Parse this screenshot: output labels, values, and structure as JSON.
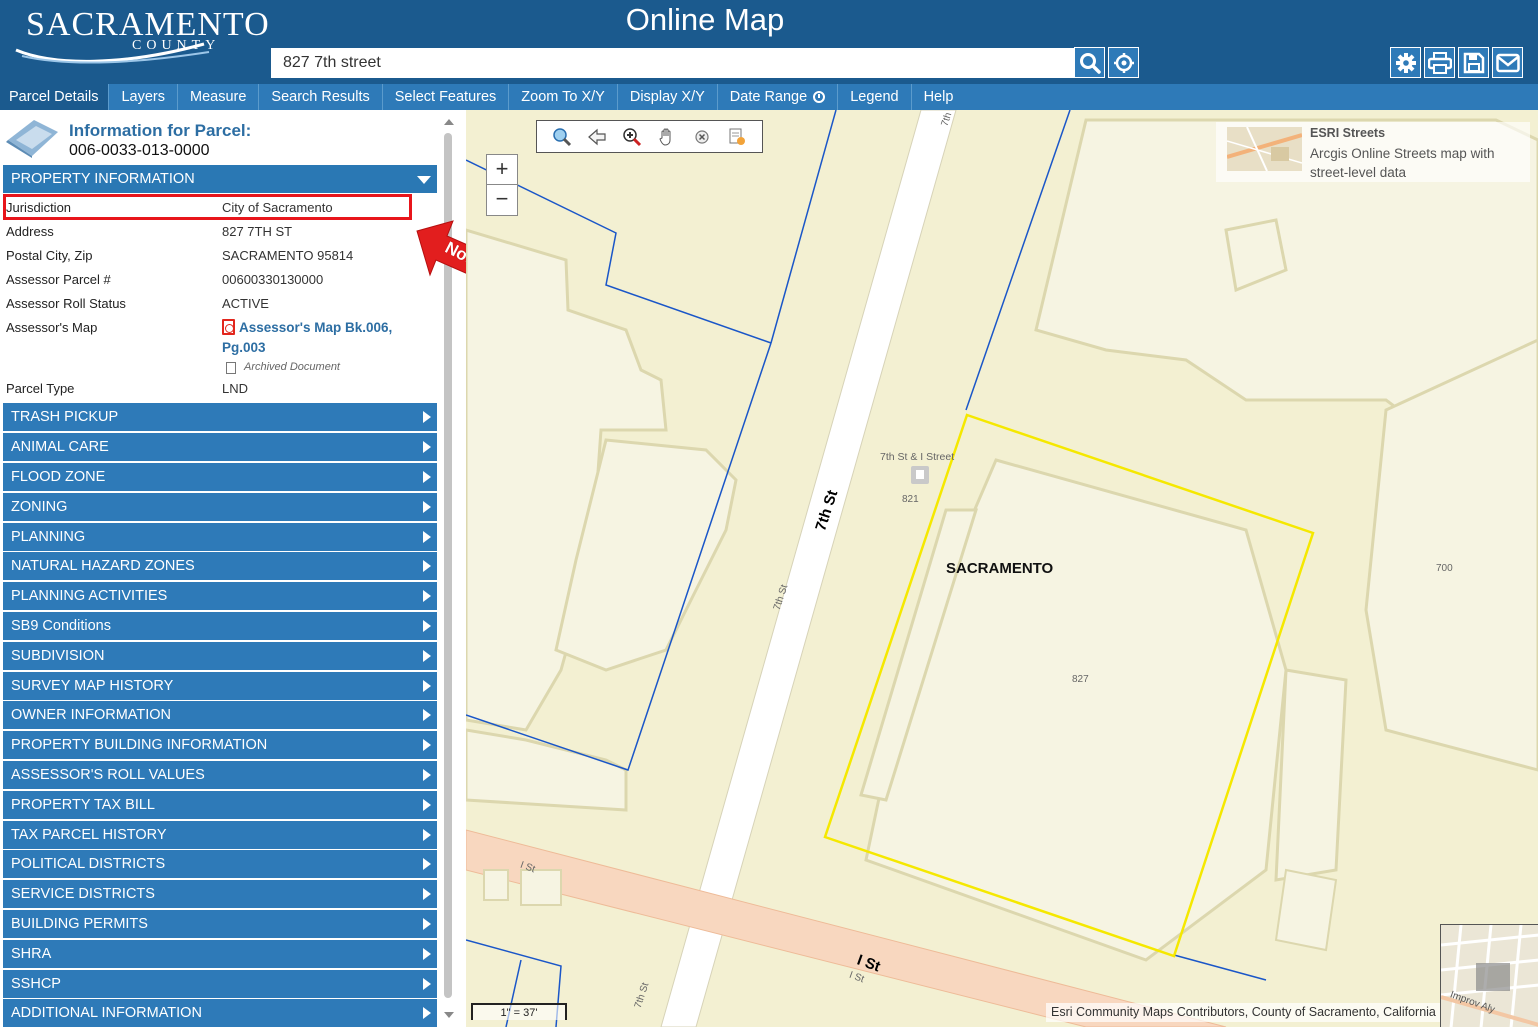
{
  "header": {
    "logo_main": "SACRAMENTO",
    "logo_sub": "COUNTY",
    "title": "Online Map",
    "search_value": "827 7th street"
  },
  "icons": {
    "search": "search-icon",
    "locate": "crosshair-icon",
    "settings": "gear-icon",
    "print": "print-icon",
    "save": "save-icon",
    "email": "envelope-icon"
  },
  "menu": [
    {
      "label": "Parcel Details",
      "active": true
    },
    {
      "label": "Layers"
    },
    {
      "label": "Measure"
    },
    {
      "label": "Search Results"
    },
    {
      "label": "Select Features"
    },
    {
      "label": "Zoom To X/Y"
    },
    {
      "label": "Display X/Y"
    },
    {
      "label": "Date Range"
    },
    {
      "label": "Legend"
    },
    {
      "label": "Help"
    }
  ],
  "parcel": {
    "title": "Information for Parcel:",
    "id": "006-0033-013-0000"
  },
  "property": {
    "header": "PROPERTY INFORMATION",
    "rows": [
      {
        "label": "Jurisdiction",
        "value": "City of Sacramento"
      },
      {
        "label": "Address",
        "value": "827 7TH ST"
      },
      {
        "label": "Postal City, Zip",
        "value": "SACRAMENTO 95814"
      },
      {
        "label": "Assessor Parcel #",
        "value": "00600330130000"
      },
      {
        "label": "Assessor Roll Status",
        "value": "ACTIVE"
      },
      {
        "label": "Assessor's Map",
        "value": ""
      },
      {
        "label": "Parcel Type",
        "value": "LND"
      }
    ],
    "map_link": "Assessor's Map Bk.006, Pg.003",
    "archived": "Archived Document"
  },
  "callout": "Not Eligible",
  "sections": [
    "TRASH PICKUP",
    "ANIMAL CARE",
    "FLOOD ZONE",
    "ZONING",
    "PLANNING",
    "NATURAL HAZARD ZONES",
    "PLANNING ACTIVITIES",
    "SB9 Conditions",
    "SUBDIVISION",
    "SURVEY MAP HISTORY",
    "OWNER INFORMATION",
    "PROPERTY BUILDING INFORMATION",
    "ASSESSOR'S ROLL VALUES",
    "PROPERTY TAX BILL",
    "TAX PARCEL HISTORY",
    "POLITICAL DISTRICTS",
    "SERVICE DISTRICTS",
    "BUILDING PERMITS",
    "SHRA",
    "SSHCP",
    "ADDITIONAL INFORMATION"
  ],
  "map": {
    "zoom_in": "+",
    "zoom_out": "−",
    "basemap_name": "ESRI Streets",
    "basemap_desc": "Arcgis Online Streets map with street-level data",
    "labels": {
      "street_7th_bold": "7th St",
      "street_7th_small_1": "7th St",
      "street_7th_small_2": "7th St",
      "street_7th_top": "7th",
      "street_i_bold": "I St",
      "street_i_small_1": "I St",
      "street_i_small_2": "I St",
      "stop": "7th St & I Street",
      "addr_821": "821",
      "addr_827": "827",
      "addr_700": "700",
      "city": "SACRAMENTO",
      "overview_text": "Improv Aly"
    },
    "scale": "1\" = 37'",
    "attribution": "Esri Community Maps Contributors, County of Sacramento, California State",
    "colors": {
      "parcel_line": "#1a56c8",
      "selected_parcel": "#f5e800",
      "street": "#ffffff",
      "major_street": "#f8d7bf",
      "ground": "#f3f0d2"
    }
  }
}
